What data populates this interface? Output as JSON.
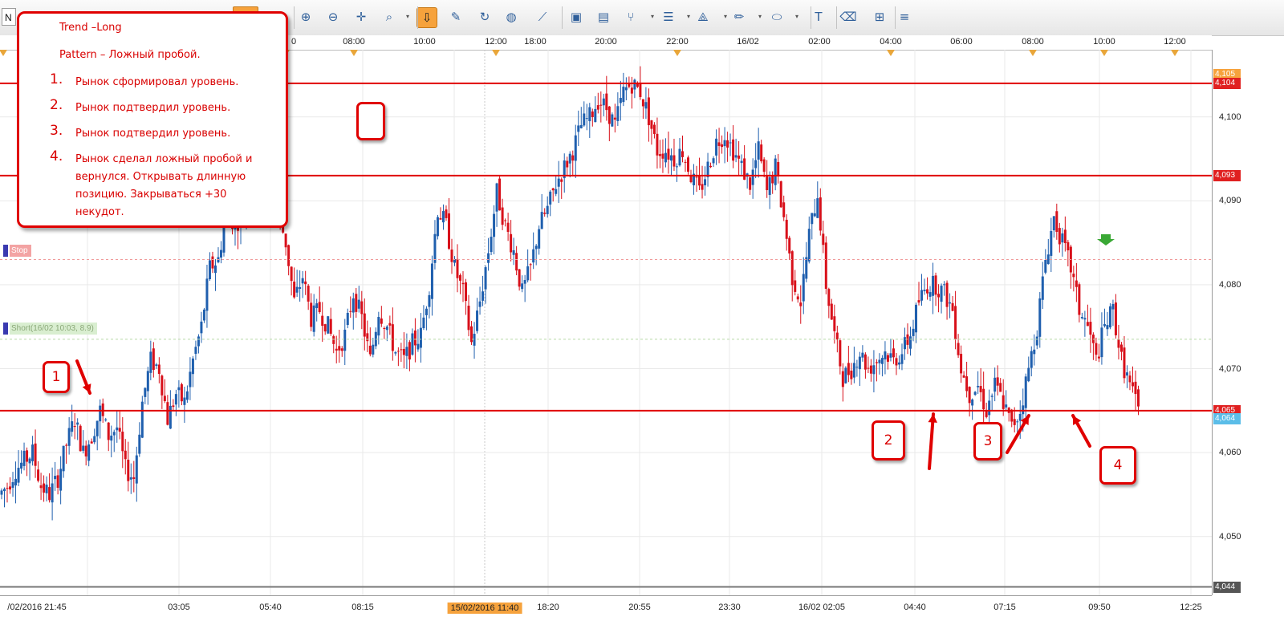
{
  "toolbar": {
    "symbol_text": "N",
    "buttons": [
      {
        "name": "zoom-in-icon",
        "glyph": "⊕"
      },
      {
        "name": "zoom-out-icon",
        "glyph": "⊖"
      },
      {
        "name": "crosshair-icon",
        "glyph": "✛"
      },
      {
        "name": "magnifier-icon",
        "glyph": "⌕"
      },
      {
        "name": "period-separator-icon",
        "glyph": "⇩",
        "active": true
      },
      {
        "name": "properties-icon",
        "glyph": "✎"
      },
      {
        "name": "refresh-icon",
        "glyph": "↻"
      },
      {
        "name": "globe-icon",
        "glyph": "◍"
      },
      {
        "name": "ruler-icon",
        "glyph": "⟋"
      },
      {
        "name": "image-icon",
        "glyph": "▣"
      },
      {
        "name": "template-icon",
        "glyph": "▤"
      },
      {
        "name": "fork-icon",
        "glyph": "⑂"
      },
      {
        "name": "lines-icon",
        "glyph": "☰"
      },
      {
        "name": "fan-icon",
        "glyph": "⟁"
      },
      {
        "name": "pencil-icon",
        "glyph": "✏"
      },
      {
        "name": "ellipse-icon",
        "glyph": "⬭"
      },
      {
        "name": "text-icon",
        "glyph": "T"
      },
      {
        "name": "eraser-icon",
        "glyph": "⌫"
      },
      {
        "name": "tree-icon",
        "glyph": "⊞"
      },
      {
        "name": "more-icon",
        "glyph": "≡"
      }
    ]
  },
  "top_axis": {
    "labels": [
      "08:00",
      "10:00",
      "12:00",
      "18:00",
      "20:00",
      "22:00",
      "16/02",
      "02:00",
      "04:00",
      "06:00",
      "08:00",
      "10:00",
      "12:00"
    ],
    "partial_left_label": "0"
  },
  "bottom_axis": {
    "labels": [
      "/02/2016 21:45",
      "03:05",
      "05:40",
      "08:15",
      "15/02/2016 11:40",
      "18:20",
      "20:55",
      "23:30",
      "16/02 02:05",
      "04:40",
      "07:15",
      "09:50",
      "12:25"
    ],
    "highlighted_label": "15/02/2016 11:40"
  },
  "price_axis": {
    "ticks": [
      "4,100",
      "4,090",
      "4,080",
      "4,070",
      "4,060",
      "4,050"
    ],
    "badges": [
      {
        "label": "4,105",
        "color": "#f6a23c"
      },
      {
        "label": "4,104",
        "color": "#e02020"
      },
      {
        "label": "4,093",
        "color": "#e02020"
      },
      {
        "label": "4,065",
        "color": "#e02020"
      },
      {
        "label": "4,064",
        "color": "#5bbde8"
      },
      {
        "label": "4,044",
        "color": "#555555"
      }
    ]
  },
  "orders": {
    "stop_label": "Stop",
    "short_label": "Short(16/02 10:03, 8.9)"
  },
  "note": {
    "title": "Trend –Long",
    "pattern": "Pattern – Ложный пробой.",
    "items": [
      {
        "num": "1.",
        "text": "Рынок сформировал уровень."
      },
      {
        "num": "2.",
        "text": "Рынок подтвердил уровень."
      },
      {
        "num": "3.",
        "text": "Рынок подтвердил уровень."
      },
      {
        "num": "4.",
        "lines": [
          "Рынок сделал ложный пробой и",
          "вернулся. Открывать длинную",
          "позицию. Закрываться +30",
          "некудот."
        ]
      }
    ]
  },
  "annotations": {
    "box1": "1",
    "box2": "2",
    "box3": "3",
    "box4": "4"
  },
  "colors": {
    "up": "#1f5fae",
    "down": "#d8101a",
    "level": "#e00000",
    "accent": "#f6a23c"
  },
  "chart_data": {
    "type": "candlestick",
    "price_range": [
      4.043,
      4.108
    ],
    "levels": [
      4.104,
      4.093,
      4.065
    ],
    "stop_level": 4.083,
    "short_level": 4.0735,
    "close_path": [
      [
        0,
        4.055
      ],
      [
        3,
        4.056
      ],
      [
        6,
        4.058
      ],
      [
        9,
        4.059
      ],
      [
        12,
        4.06
      ],
      [
        15,
        4.056
      ],
      [
        18,
        4.055
      ],
      [
        21,
        4.057
      ],
      [
        24,
        4.061
      ],
      [
        27,
        4.064
      ],
      [
        30,
        4.06
      ],
      [
        33,
        4.062
      ],
      [
        36,
        4.065
      ],
      [
        39,
        4.062
      ],
      [
        42,
        4.063
      ],
      [
        45,
        4.058
      ],
      [
        48,
        4.057
      ],
      [
        51,
        4.066
      ],
      [
        54,
        4.071
      ],
      [
        57,
        4.07
      ],
      [
        60,
        4.064
      ],
      [
        63,
        4.067
      ],
      [
        66,
        4.066
      ],
      [
        69,
        4.071
      ],
      [
        72,
        4.075
      ],
      [
        75,
        4.082
      ],
      [
        78,
        4.083
      ],
      [
        81,
        4.089
      ],
      [
        84,
        4.087
      ],
      [
        87,
        4.089
      ],
      [
        90,
        4.09
      ],
      [
        93,
        4.091
      ],
      [
        96,
        4.092
      ],
      [
        99,
        4.089
      ],
      [
        102,
        4.085
      ],
      [
        105,
        4.078
      ],
      [
        108,
        4.081
      ],
      [
        111,
        4.076
      ],
      [
        114,
        4.077
      ],
      [
        117,
        4.075
      ],
      [
        120,
        4.072
      ],
      [
        123,
        4.074
      ],
      [
        126,
        4.079
      ],
      [
        129,
        4.076
      ],
      [
        132,
        4.071
      ],
      [
        135,
        4.077
      ],
      [
        138,
        4.075
      ],
      [
        141,
        4.072
      ],
      [
        144,
        4.071
      ],
      [
        147,
        4.073
      ],
      [
        150,
        4.074
      ],
      [
        153,
        4.08
      ],
      [
        156,
        4.089
      ],
      [
        159,
        4.087
      ],
      [
        162,
        4.082
      ],
      [
        165,
        4.079
      ],
      [
        168,
        4.073
      ],
      [
        171,
        4.078
      ],
      [
        174,
        4.084
      ],
      [
        177,
        4.091
      ],
      [
        180,
        4.087
      ],
      [
        183,
        4.084
      ],
      [
        186,
        4.079
      ],
      [
        189,
        4.082
      ],
      [
        192,
        4.087
      ],
      [
        195,
        4.089
      ],
      [
        198,
        4.092
      ],
      [
        201,
        4.094
      ],
      [
        204,
        4.096
      ],
      [
        207,
        4.099
      ],
      [
        210,
        4.1
      ],
      [
        213,
        4.102
      ],
      [
        216,
        4.101
      ],
      [
        219,
        4.099
      ],
      [
        222,
        4.103
      ],
      [
        225,
        4.104
      ],
      [
        228,
        4.103
      ],
      [
        231,
        4.1
      ],
      [
        234,
        4.096
      ],
      [
        237,
        4.096
      ],
      [
        240,
        4.095
      ],
      [
        243,
        4.096
      ],
      [
        246,
        4.093
      ],
      [
        249,
        4.091
      ],
      [
        252,
        4.094
      ],
      [
        255,
        4.097
      ],
      [
        258,
        4.098
      ],
      [
        261,
        4.096
      ],
      [
        264,
        4.094
      ],
      [
        267,
        4.092
      ],
      [
        270,
        4.096
      ],
      [
        273,
        4.091
      ],
      [
        276,
        4.094
      ],
      [
        279,
        4.088
      ],
      [
        282,
        4.081
      ],
      [
        285,
        4.078
      ],
      [
        288,
        4.086
      ],
      [
        291,
        4.091
      ],
      [
        294,
        4.08
      ],
      [
        297,
        4.074
      ],
      [
        300,
        4.069
      ],
      [
        303,
        4.07
      ],
      [
        306,
        4.072
      ],
      [
        309,
        4.07
      ],
      [
        312,
        4.071
      ],
      [
        315,
        4.072
      ],
      [
        318,
        4.071
      ],
      [
        321,
        4.072
      ],
      [
        324,
        4.074
      ],
      [
        327,
        4.078
      ],
      [
        330,
        4.08
      ],
      [
        333,
        4.08
      ],
      [
        336,
        4.079
      ],
      [
        339,
        4.077
      ],
      [
        342,
        4.07
      ],
      [
        345,
        4.067
      ],
      [
        348,
        4.068
      ],
      [
        351,
        4.065
      ],
      [
        354,
        4.068
      ],
      [
        357,
        4.066
      ],
      [
        360,
        4.063
      ],
      [
        363,
        4.065
      ],
      [
        366,
        4.07
      ],
      [
        369,
        4.075
      ],
      [
        372,
        4.083
      ],
      [
        375,
        4.088
      ],
      [
        378,
        4.085
      ],
      [
        381,
        4.082
      ],
      [
        384,
        4.077
      ],
      [
        387,
        4.075
      ],
      [
        390,
        4.071
      ],
      [
        393,
        4.075
      ],
      [
        396,
        4.077
      ],
      [
        399,
        4.071
      ],
      [
        402,
        4.068
      ],
      [
        405,
        4.065
      ]
    ]
  }
}
